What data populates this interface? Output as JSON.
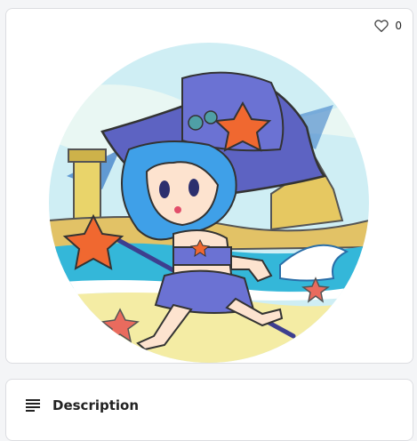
{
  "favorite": {
    "count": "0",
    "icon": "heart-outline-icon"
  },
  "artwork": {
    "alt_icon": "chibi-sea-witch-illustration"
  },
  "description": {
    "title": "Description",
    "icon": "text-lines-icon"
  }
}
